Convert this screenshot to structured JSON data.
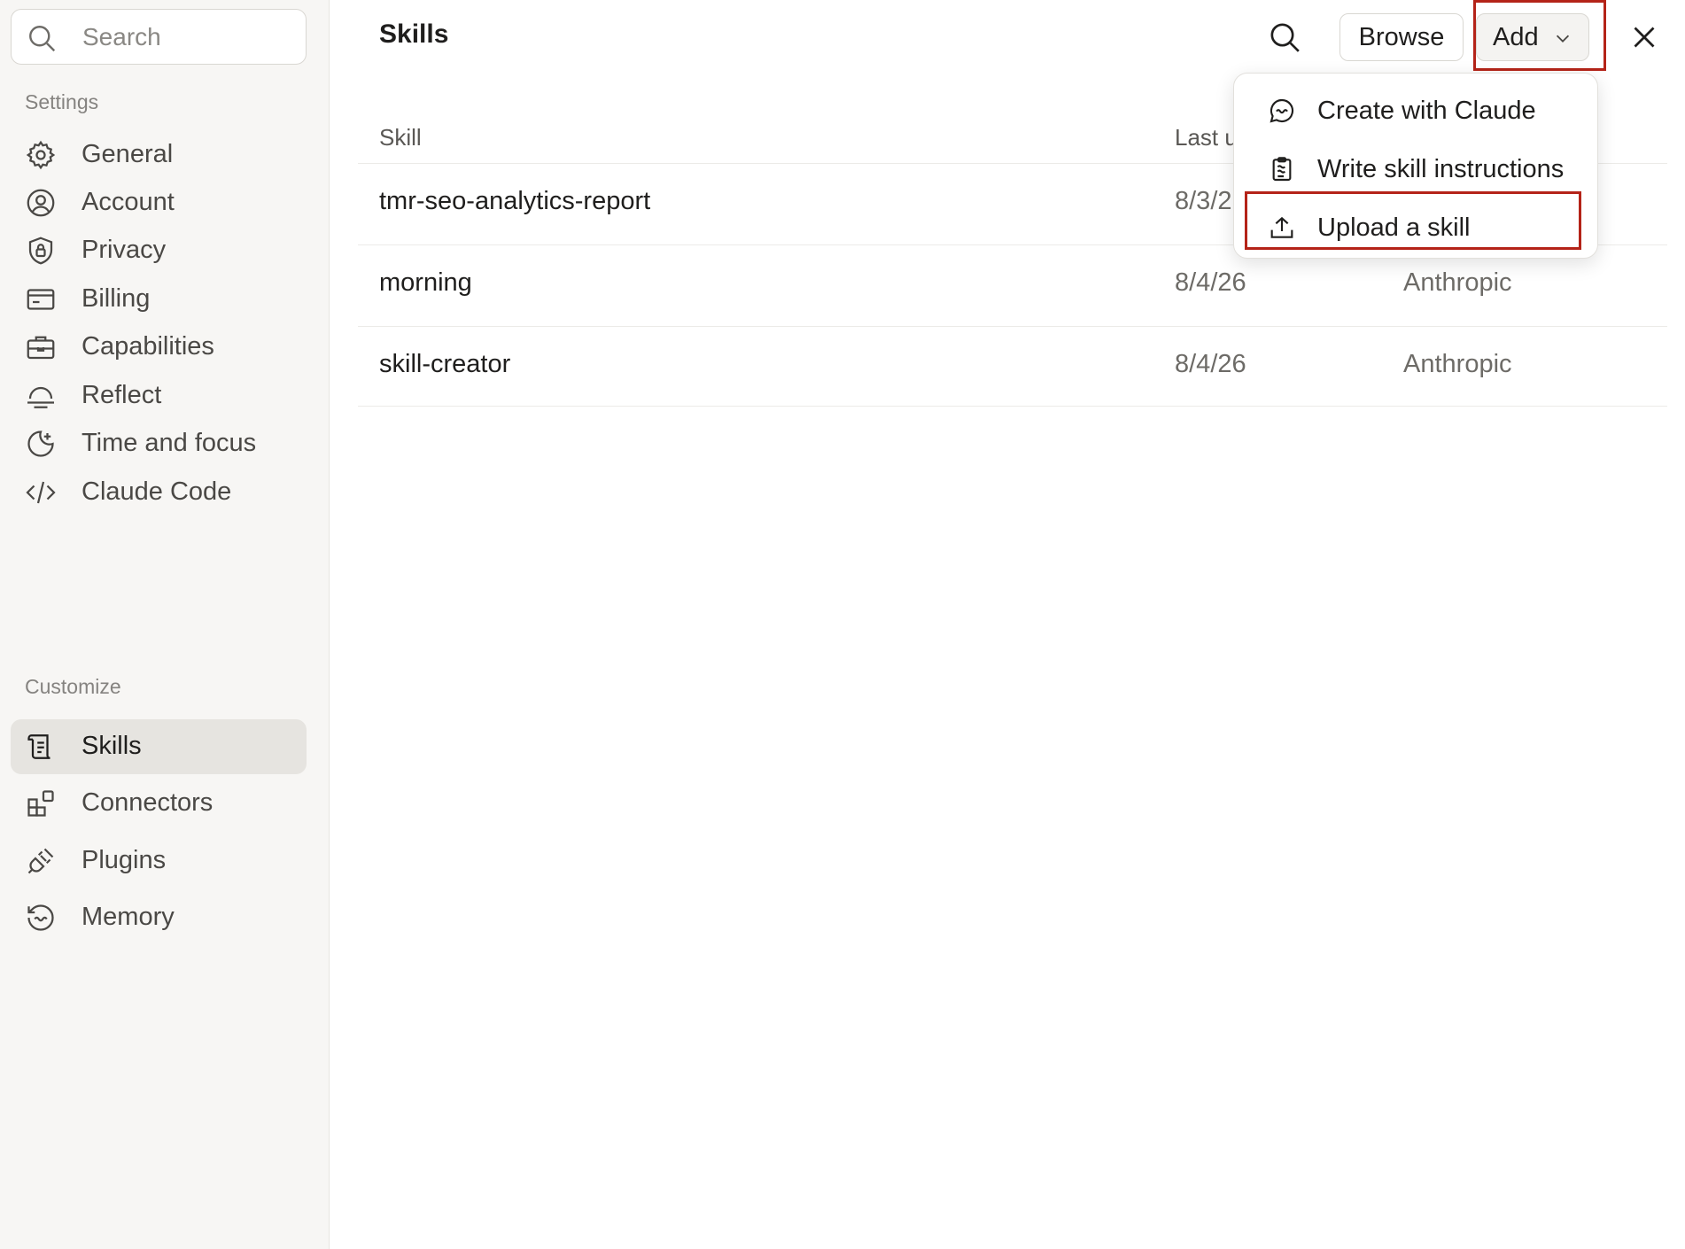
{
  "sidebar": {
    "search": {
      "placeholder": "Search",
      "icon": "search-icon"
    },
    "settings_label": "Settings",
    "settings_items": [
      {
        "label": "General",
        "icon": "gear-icon"
      },
      {
        "label": "Account",
        "icon": "user-circle-icon"
      },
      {
        "label": "Privacy",
        "icon": "shield-lock-icon"
      },
      {
        "label": "Billing",
        "icon": "credit-card-icon"
      },
      {
        "label": "Capabilities",
        "icon": "briefcase-icon"
      },
      {
        "label": "Reflect",
        "icon": "horizon-icon"
      },
      {
        "label": "Time and focus",
        "icon": "moon-sparkle-icon"
      },
      {
        "label": "Claude Code",
        "icon": "code-brackets-icon"
      }
    ],
    "customize_label": "Customize",
    "customize_items": [
      {
        "label": "Skills",
        "icon": "scroll-icon",
        "active": true
      },
      {
        "label": "Connectors",
        "icon": "blocks-icon"
      },
      {
        "label": "Plugins",
        "icon": "plug-icon"
      },
      {
        "label": "Memory",
        "icon": "memory-icon"
      }
    ]
  },
  "header": {
    "title": "Skills",
    "browse_label": "Browse",
    "add_label": "Add"
  },
  "table": {
    "columns": [
      "Skill",
      "Last u"
    ],
    "rows": [
      {
        "name": "tmr-seo-analytics-report",
        "date": "8/3/2",
        "owner": ""
      },
      {
        "name": "morning",
        "date": "8/4/26",
        "owner": "Anthropic"
      },
      {
        "name": "skill-creator",
        "date": "8/4/26",
        "owner": "Anthropic"
      }
    ]
  },
  "add_menu": {
    "items": [
      {
        "label": "Create with Claude",
        "icon": "chat-bubble-icon"
      },
      {
        "label": "Write skill instructions",
        "icon": "clipboard-icon"
      },
      {
        "label": "Upload a skill",
        "icon": "upload-icon",
        "highlighted": true
      }
    ]
  },
  "colors": {
    "highlight": "#b42318",
    "sidebar_bg": "#f7f6f4",
    "active_item_bg": "#e6e4e0"
  }
}
